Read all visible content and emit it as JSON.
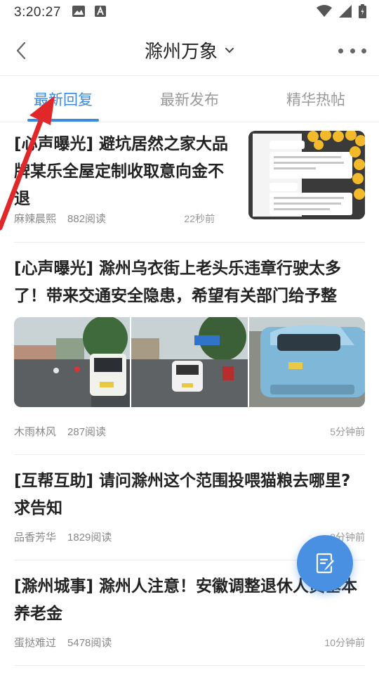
{
  "status_bar": {
    "time": "3:20:27",
    "left_icons": [
      "image-icon",
      "font-a-icon"
    ],
    "right_icons": [
      "wifi-icon",
      "signal-icon",
      "battery-icon"
    ]
  },
  "nav": {
    "back_icon": "back-arrow-icon",
    "title": "滁州万象",
    "title_dropdown_icon": "chevron-down-icon",
    "more_icon": "more-dots-icon"
  },
  "tabs": [
    {
      "label": "最新回复",
      "active": true
    },
    {
      "label": "最新发布",
      "active": false
    },
    {
      "label": "精华热帖",
      "active": false
    }
  ],
  "posts": [
    {
      "title": "[心声曝光] 避坑居然之家大品牌某乐全屋定制收取意向金不退",
      "author": "麻辣晨熙",
      "reads": "882阅读",
      "time": "22秒前"
    },
    {
      "title": "[心声曝光] 滁州乌衣街上老头乐违章行驶太多了！带来交通安全隐患，希望有关部门给予整",
      "author": "木雨林风",
      "reads": "287阅读",
      "time": "5分钟前"
    },
    {
      "title": "[互帮互助] 请问滁州这个范围投喂猫粮去哪里?求告知",
      "author": "品香芳华",
      "reads": "1829阅读",
      "time": "8分钟前"
    },
    {
      "title": "[滁州城事] 滁州人注意！安徽调整退休人员基本养老金",
      "author": "蛋挞难过",
      "reads": "5478阅读",
      "time": "10分钟前"
    }
  ],
  "fab": {
    "icon": "edit-post-icon"
  },
  "colors": {
    "accent": "#3b8ae0",
    "fab": "#4a90e2",
    "annotation_arrow": "#e0282a"
  }
}
